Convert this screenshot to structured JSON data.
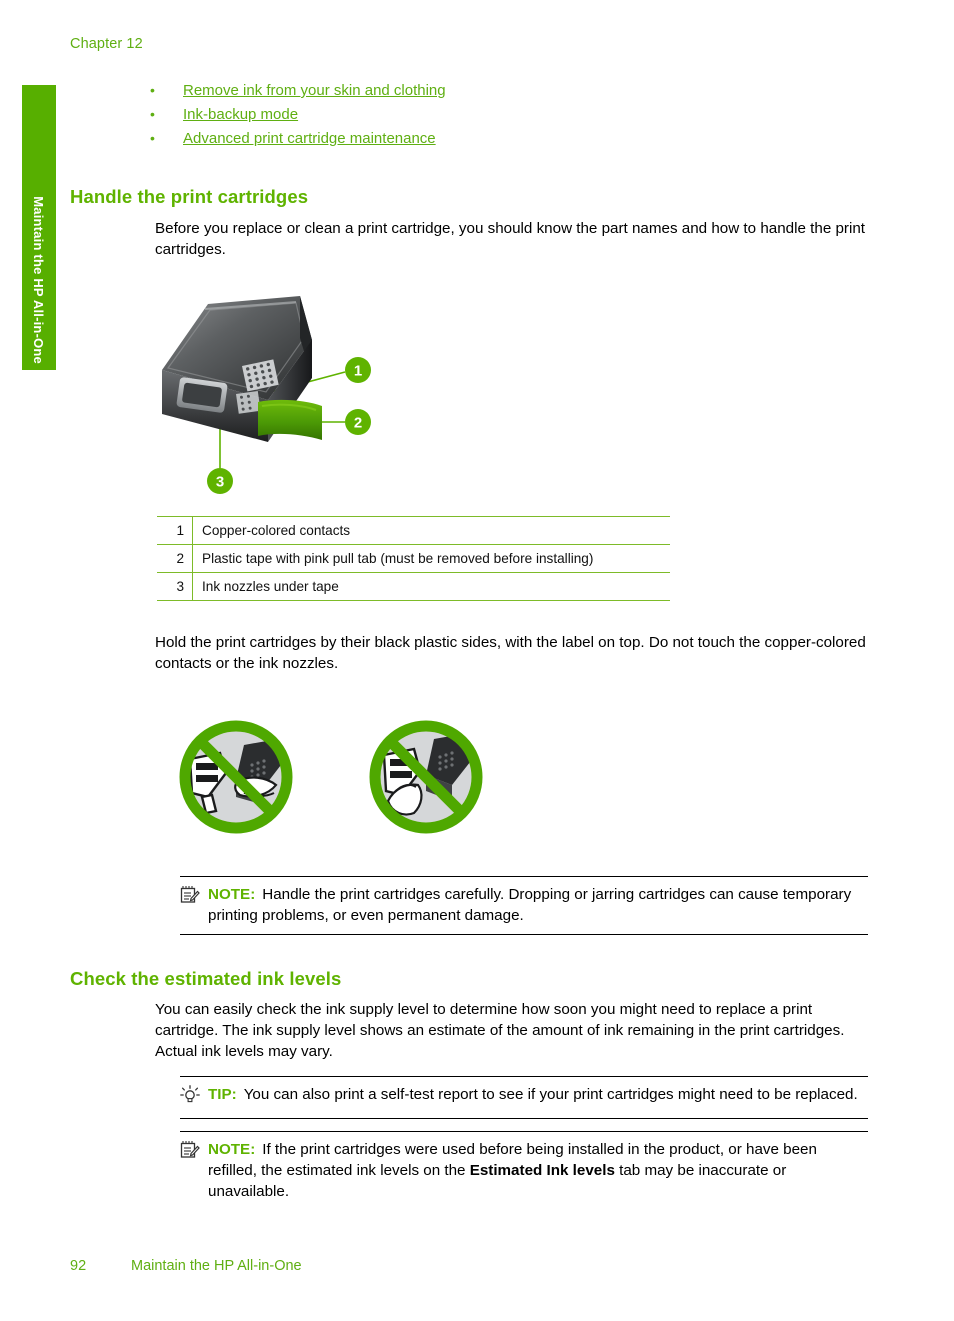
{
  "page": {
    "chapter_label": "Chapter 12",
    "side_tab_text": "Maintain the HP All-in-One",
    "footer_page_number": "92",
    "footer_title": "Maintain the HP All-in-One",
    "accent_green": "#5FB300",
    "tab_green": "#57AF00",
    "link_green": "#5FAF12",
    "rule_green": "#7DBB28"
  },
  "link_list": {
    "bullet": "•",
    "items": [
      {
        "label": "Remove ink from your skin and clothing"
      },
      {
        "label": "Ink-backup mode"
      },
      {
        "label": "Advanced print cartridge maintenance"
      }
    ]
  },
  "section_handle": {
    "heading": "Handle the print cartridges",
    "intro": "Before you replace or clean a print cartridge, you should know the part names and how to handle the print cartridges.",
    "figure": {
      "alt": "print-cartridge-callout-diagram",
      "callouts": [
        {
          "number": "1"
        },
        {
          "number": "2"
        },
        {
          "number": "3"
        }
      ]
    },
    "legend": {
      "rows": [
        {
          "num": "1",
          "text": "Copper-colored contacts"
        },
        {
          "num": "2",
          "text": "Plastic tape with pink pull tab (must be removed before installing)"
        },
        {
          "num": "3",
          "text": "Ink nozzles under tape"
        }
      ]
    },
    "hold_para": "Hold the print cartridges by their black plastic sides, with the label on top. Do not touch the copper-colored contacts or the ink nozzles.",
    "prohibition_figure": {
      "alt": "do-not-touch-contacts-and-nozzles-diagram"
    },
    "note": {
      "icon": "note-icon",
      "keyword": "NOTE:",
      "text": "Handle the print cartridges carefully. Dropping or jarring cartridges can cause temporary printing problems, or even permanent damage."
    }
  },
  "section_ink_levels": {
    "heading": "Check the estimated ink levels",
    "intro": "You can easily check the ink supply level to determine how soon you might need to replace a print cartridge. The ink supply level shows an estimate of the amount of ink remaining in the print cartridges. Actual ink levels may vary.",
    "tip": {
      "icon": "lightbulb-icon",
      "keyword": "TIP:",
      "text": "You can also print a self-test report to see if your print cartridges might need to be replaced."
    },
    "note": {
      "icon": "note-icon",
      "keyword": "NOTE:",
      "text_before": "If the print cartridges were used before being installed in the product, or have been refilled, the estimated ink levels on the ",
      "text_bold": "Estimated Ink levels",
      "text_after": " tab may be inaccurate or unavailable."
    }
  }
}
